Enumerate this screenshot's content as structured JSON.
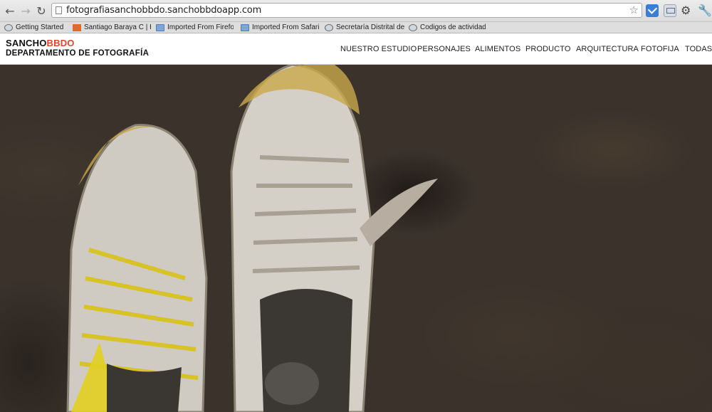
{
  "browser": {
    "url": "fotografiasanchobbdo.sanchobbdoapp.com",
    "icons": [
      "back-icon",
      "forward-icon",
      "reload-icon",
      "star-icon",
      "gear-icon",
      "wrench-icon"
    ]
  },
  "bookmarks": [
    {
      "label": "Getting Started",
      "icon": "globe"
    },
    {
      "label": "Santiago Baraya C | F",
      "icon": "orange"
    },
    {
      "label": "Imported From Firefox",
      "icon": "folder"
    },
    {
      "label": "Imported From Safari",
      "icon": "folder"
    },
    {
      "label": "Secretaría Distrital de",
      "icon": "globe"
    },
    {
      "label": "Codigos de actividad",
      "icon": "globe"
    }
  ],
  "site": {
    "logo_main": "SANCHO",
    "logo_accent": "BBDO",
    "subtitle": "DEPARTAMENTO DE FOTOGRAFÍA",
    "accent_color": "#e8402a",
    "nav": [
      "NUESTRO ESTUDIO",
      "PERSONAJES",
      "ALIMENTOS",
      "PRODUCTO",
      "ARQUITECTURA",
      "FOTOFIJA",
      "TODAS"
    ]
  },
  "hero": {
    "subject": "photo"
  }
}
